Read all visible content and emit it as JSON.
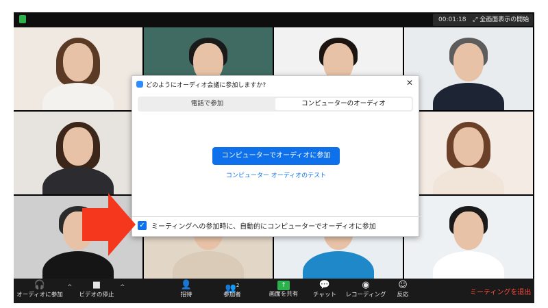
{
  "topbar": {
    "timer": "00:01:18",
    "fullscreen_label": "全画面表示の開始"
  },
  "dialog": {
    "title": "どのようにオーディオ会議に参加しますか?",
    "close": "✕",
    "tabs": [
      {
        "label": "電話で参加",
        "active": false
      },
      {
        "label": "コンピューターのオーディオ",
        "active": true
      }
    ],
    "join_button": "コンピューターでオーディオに参加",
    "test_link": "コンピューター オーディオのテスト",
    "auto_join_label": "ミーティングへの参加時に、自動的にコンピューターでオーディオに参加",
    "auto_join_checked": true
  },
  "controls": {
    "audio": {
      "label": "オーディオに参加",
      "icon": "headphones-icon"
    },
    "video": {
      "label": "ビデオの停止",
      "icon": "camera-icon"
    },
    "invite": {
      "label": "招待",
      "icon": "add-person-icon"
    },
    "participants": {
      "label": "参加者",
      "count": "2",
      "icon": "participants-icon"
    },
    "share": {
      "label": "画面を共有",
      "icon": "share-screen-icon"
    },
    "chat": {
      "label": "チャット",
      "icon": "chat-icon"
    },
    "record": {
      "label": "レコーディング",
      "icon": "record-icon"
    },
    "reactions": {
      "label": "反応",
      "icon": "emoji-icon"
    },
    "leave": "ミーティングを退出"
  },
  "colors": {
    "accent": "#0e71eb",
    "leave": "#ff4b3e",
    "share": "#2bb24c",
    "arrow": "#f5371d"
  }
}
